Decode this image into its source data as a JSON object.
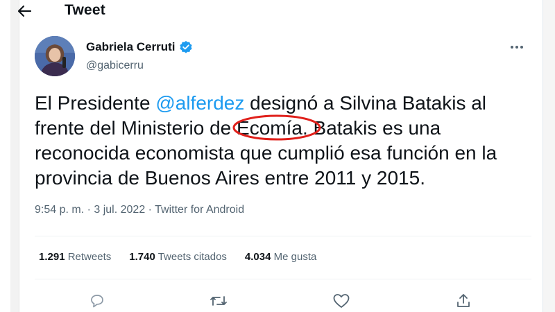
{
  "header": {
    "title": "Tweet",
    "back_icon": "arrow-left-icon"
  },
  "author": {
    "display_name": "Gabriela Cerruti",
    "handle": "@gabicerru",
    "verified_icon": "verified-badge-icon",
    "badge_color": "#1d9bf0"
  },
  "tweet": {
    "text_part1": "El Presidente ",
    "mention": "@alferdez",
    "text_part2": " designó a Silvina Batakis al frente del Ministerio de ",
    "circled_text": "Ecomía.",
    "text_part3": " Batakis es una reconocida economista que cumplió esa función en la provincia de Buenos Aires entre 2011 y 2015.",
    "annotation_color": "#e0201b"
  },
  "meta": {
    "time": "9:54 p. m.",
    "separator": " · ",
    "date": "3 jul. 2022",
    "source": "Twitter for Android"
  },
  "stats": [
    {
      "count": "1.291",
      "label": "Retweets"
    },
    {
      "count": "1.740",
      "label": "Tweets citados"
    },
    {
      "count": "4.034",
      "label": "Me gusta"
    }
  ],
  "actions": [
    "reply-icon",
    "retweet-icon",
    "like-icon",
    "share-icon"
  ],
  "colors": {
    "accent": "#1d9bf0",
    "text": "#0f1419",
    "secondary": "#536471"
  }
}
